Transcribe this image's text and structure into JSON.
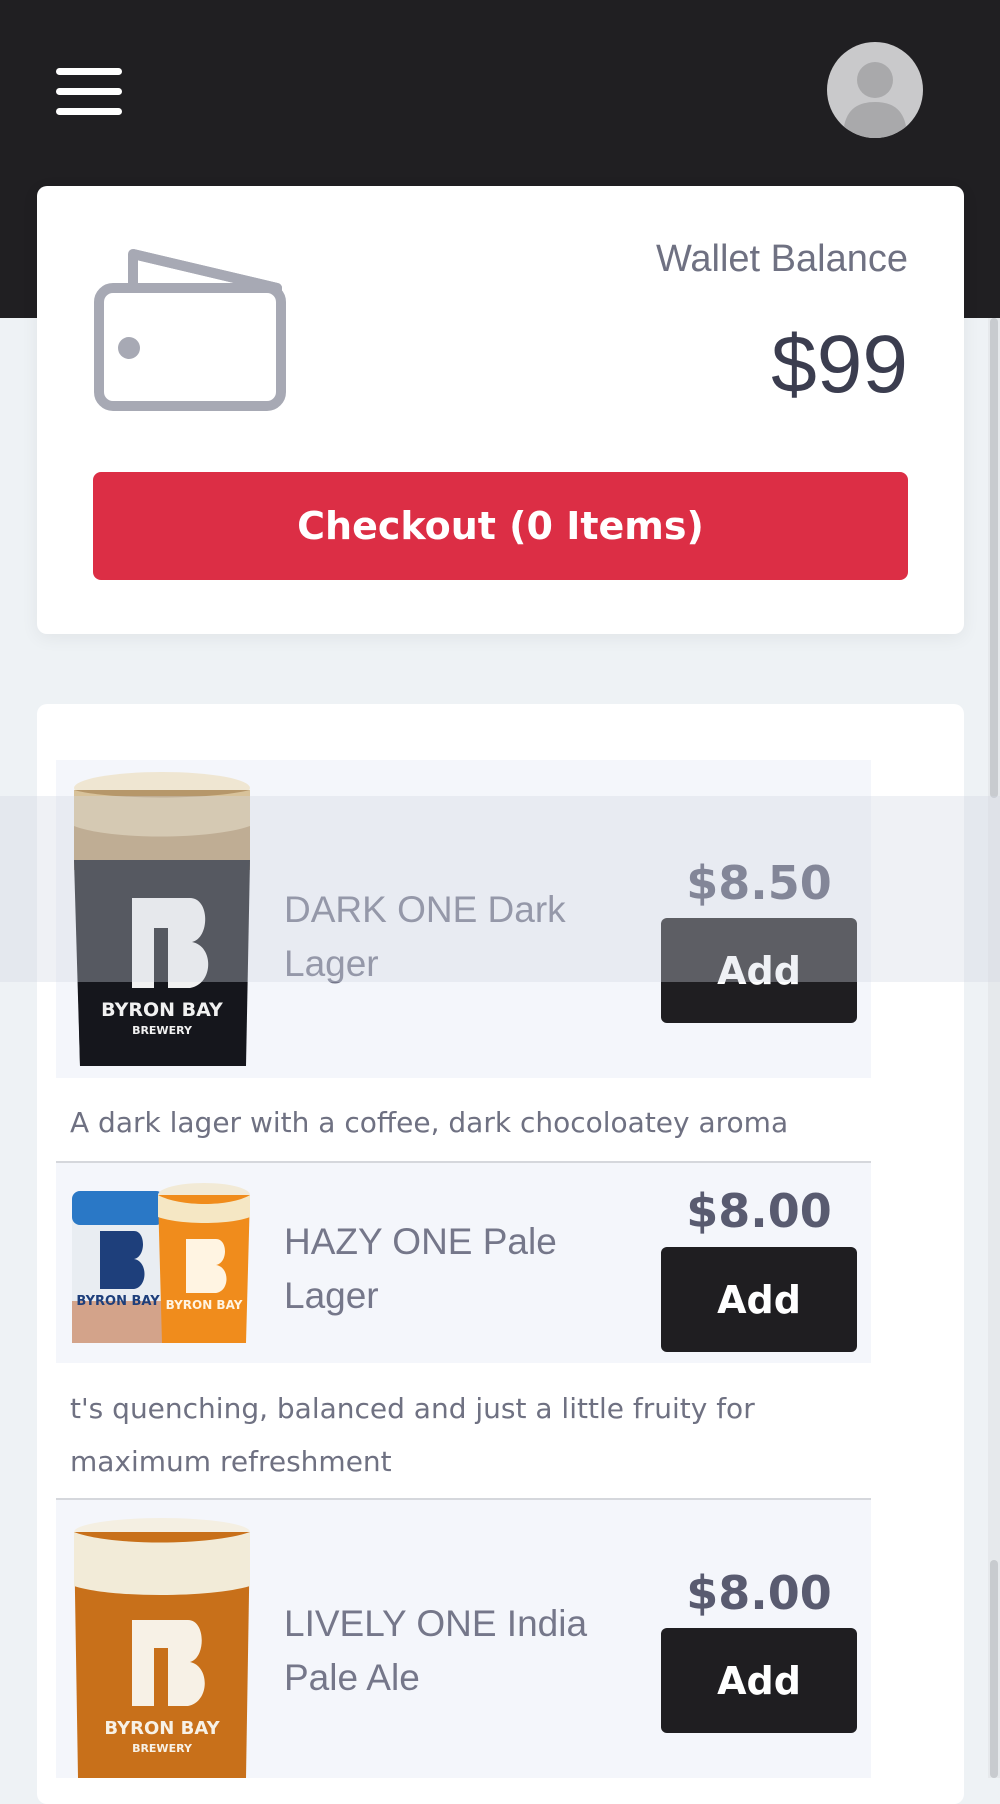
{
  "header": {
    "menu_icon": "hamburger-menu-icon",
    "avatar_icon": "user-avatar-icon"
  },
  "wallet": {
    "icon": "wallet-icon",
    "label": "Wallet Balance",
    "amount": "$99",
    "checkout_label": "Checkout (0 Items)",
    "accent_color": "#dc2e45"
  },
  "products": [
    {
      "name": "DARK ONE Dark Lager",
      "price": "$8.50",
      "add_label": "Add",
      "description": "A dark lager with a coffee, dark chocoloatey aroma",
      "image": "dark-lager-glass"
    },
    {
      "name": "HAZY ONE Pale Lager",
      "price": "$8.00",
      "add_label": "Add",
      "description": "t's quenching, balanced and just a little fruity for maximum refreshment",
      "image": "hazy-pale-lager-can-and-glass"
    },
    {
      "name": "LIVELY ONE India Pale Ale",
      "price": "$8.00",
      "add_label": "Add",
      "description": "",
      "image": "lively-ipa-glass"
    }
  ],
  "brand_logo_text": {
    "line1": "BYRON BAY",
    "line2": "BREWERY"
  }
}
